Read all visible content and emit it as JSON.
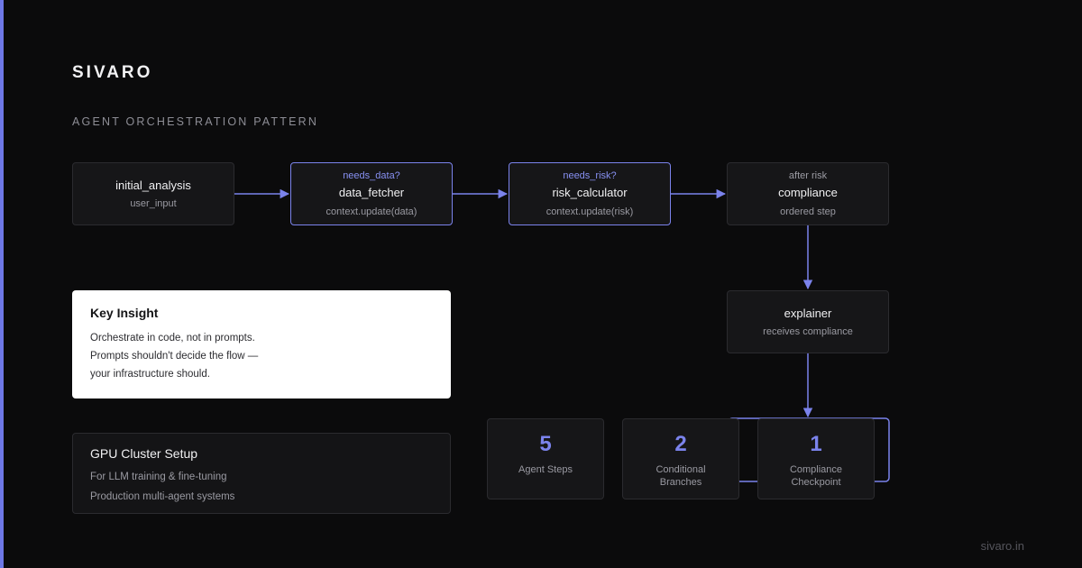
{
  "brand": "SIVARO",
  "subtitle": "AGENT ORCHESTRATION PATTERN",
  "nodes": {
    "initial_analysis": {
      "title": "initial_analysis",
      "sub": "user_input"
    },
    "data_fetcher": {
      "condition": "needs_data?",
      "title": "data_fetcher",
      "sub": "context.update(data)"
    },
    "risk_calculator": {
      "condition": "needs_risk?",
      "title": "risk_calculator",
      "sub": "context.update(risk)"
    },
    "compliance": {
      "condition": "after risk",
      "title": "compliance",
      "sub": "ordered step"
    },
    "explainer": {
      "title": "explainer",
      "sub": "receives compliance"
    }
  },
  "insight": {
    "heading": "Key Insight",
    "lines": [
      "Orchestrate in code, not in prompts.",
      "Prompts shouldn't decide the flow —",
      "your infrastructure should."
    ]
  },
  "gpu": {
    "heading": "GPU Cluster Setup",
    "lines": [
      "For LLM training & fine-tuning",
      "Production multi-agent systems"
    ]
  },
  "stats": [
    {
      "value": "5",
      "label": "Agent Steps"
    },
    {
      "value": "2",
      "label": "Conditional Branches"
    },
    {
      "value": "1",
      "label": "Compliance Checkpoint"
    }
  ],
  "footer": "sivaro.in",
  "colors": {
    "accent": "#7b83ec",
    "background": "#0b0b0c",
    "card": "#161618",
    "border": "#2b2b2f"
  }
}
